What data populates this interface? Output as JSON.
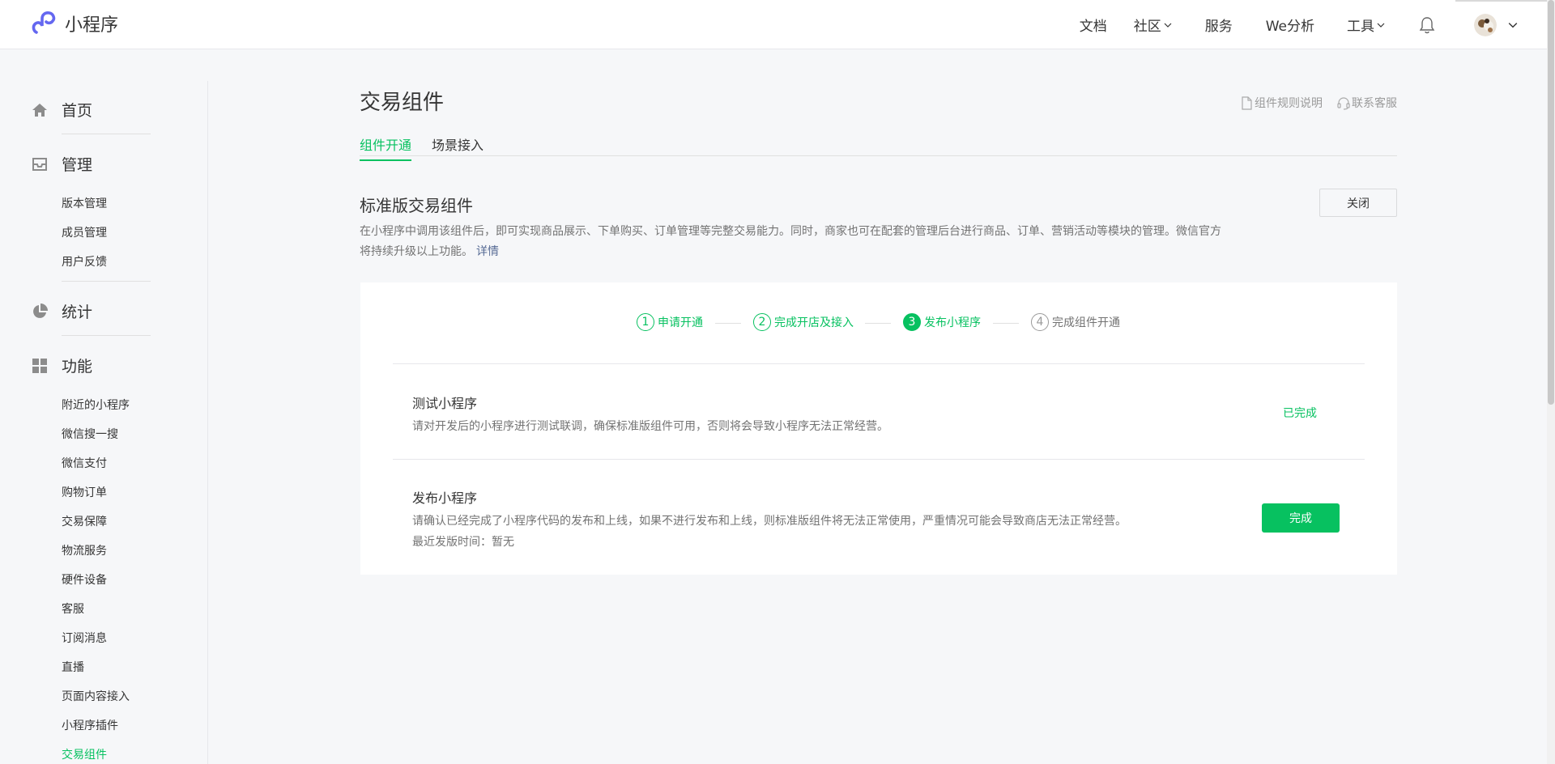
{
  "header": {
    "logo_text": "小程序",
    "nav": [
      {
        "label": "文档"
      },
      {
        "label": "社区"
      },
      {
        "label": "服务"
      },
      {
        "label": "We分析"
      },
      {
        "label": "工具"
      }
    ]
  },
  "sidebar": {
    "home": "首页",
    "manage": {
      "label": "管理",
      "items": [
        "版本管理",
        "成员管理",
        "用户反馈"
      ]
    },
    "stats": "统计",
    "features": {
      "label": "功能",
      "items": [
        "附近的小程序",
        "微信搜一搜",
        "微信支付",
        "购物订单",
        "交易保障",
        "物流服务",
        "硬件设备",
        "客服",
        "订阅消息",
        "直播",
        "页面内容接入",
        "小程序插件",
        "交易组件"
      ],
      "active": "交易组件"
    }
  },
  "main": {
    "title": "交易组件",
    "links": {
      "rules": "组件规则说明",
      "support": "联系客服"
    },
    "tabs": [
      {
        "label": "组件开通",
        "active": true
      },
      {
        "label": "场景接入",
        "active": false
      }
    ],
    "section_title": "标准版交易组件",
    "close_label": "关闭",
    "desc_line1": "在小程序中调用该组件后，即可实现商品展示、下单购买、订单管理等完整交易能力。同时，商家也可在配套的管理后台进行商品、订单、营销活动等模块的管理。微信官方",
    "desc_line2": "将持续升级以上功能。",
    "desc_more": "详情",
    "steps": [
      {
        "num": "1",
        "label": "申请开通",
        "state": "done"
      },
      {
        "num": "2",
        "label": "完成开店及接入",
        "state": "done"
      },
      {
        "num": "3",
        "label": "发布小程序",
        "state": "current"
      },
      {
        "num": "4",
        "label": "完成组件开通",
        "state": "todo"
      }
    ],
    "tasks": [
      {
        "title": "测试小程序",
        "desc": "请对开发后的小程序进行测试联调，确保标准版组件可用，否则将会导致小程序无法正常经营。",
        "status": "已完成"
      },
      {
        "title": "发布小程序",
        "desc": "请确认已经完成了小程序代码的发布和上线，如果不进行发布和上线，则标准版组件将无法正常使用，严重情况可能会导致商店无法正常经营。",
        "extra": "最近发版时间：暂无",
        "button": "完成"
      }
    ]
  },
  "colors": {
    "brand_green": "#07c160",
    "link_blue": "#576b95"
  }
}
